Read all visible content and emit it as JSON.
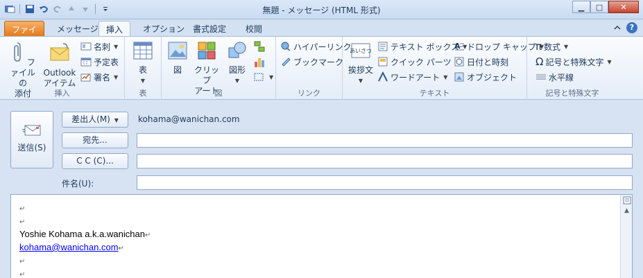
{
  "window": {
    "title": "無題 - メッセージ (HTML 形式)",
    "controls": {
      "minimize": "▁",
      "maximize": "□",
      "close": "✕"
    }
  },
  "tabs": [
    {
      "label": "ファイル"
    },
    {
      "label": "メッセージ"
    },
    {
      "label": "挿入"
    },
    {
      "label": "オプション"
    },
    {
      "label": "書式設定"
    },
    {
      "label": "校閲"
    }
  ],
  "help_label": "?",
  "ribbon": {
    "insert": {
      "group_label": "挿入",
      "attach_file": "ファイルの\n添付",
      "outlook_item": "Outlook\nアイテム",
      "business_card": "名刺",
      "calendar": "予定表",
      "signature": "署名"
    },
    "table": {
      "group_label": "表",
      "table_button": "表"
    },
    "illustrations": {
      "group_label": "図",
      "picture": "図",
      "clipart": "クリップ\nアート",
      "shapes": "図形"
    },
    "links": {
      "group_label": "リンク",
      "hyperlink": "ハイパーリンク",
      "bookmark": "ブックマーク"
    },
    "text": {
      "group_label": "テキスト",
      "greeting": "挨拶文",
      "textbox": "テキスト ボックス",
      "quickparts": "クイック パーツ",
      "wordart": "ワードアート",
      "dropcap": "ドロップ キャップ",
      "datetime": "日付と時刻",
      "object": "オブジェクト"
    },
    "symbols": {
      "group_label": "記号と特殊文字",
      "equation": "数式",
      "symbol": "記号と特殊文字",
      "hline": "水平線"
    }
  },
  "compose": {
    "send_label": "送信(S)",
    "from_button": "差出人(M)",
    "from_value": "kohama@wanichan.com",
    "to_button": "宛先...",
    "cc_button": "C C (C)...",
    "subject_label": "件名(U):",
    "to_value": "",
    "cc_value": "",
    "subject_value": ""
  },
  "body": {
    "lines": [
      "",
      "",
      "Yoshie Kohama a.k.a.wanichan",
      "kohama@wanichan.com",
      "",
      ""
    ]
  },
  "colors": {
    "accent_file_tab": "#e27a1e",
    "link": "#0000ff"
  }
}
